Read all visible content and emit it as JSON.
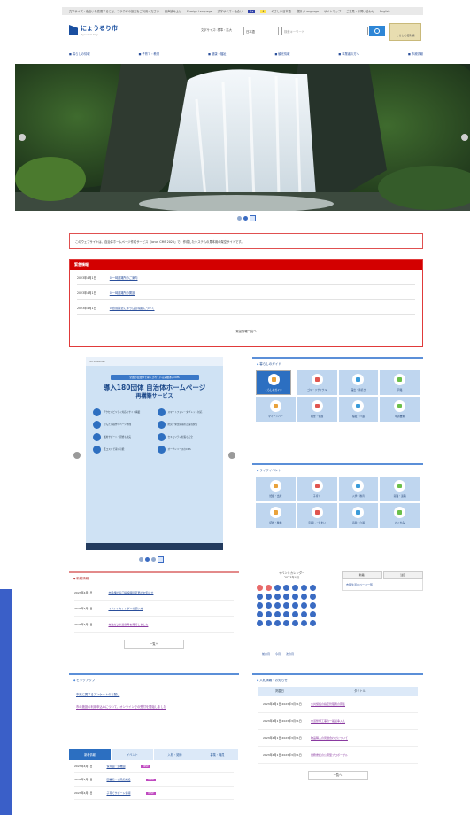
{
  "topbar": {
    "items": [
      "文字サイズ・色合いを変更するには、ブラウザの設定をご利用ください",
      "音声読み上げ",
      "Foreign Language",
      "文字サイズ・色合い",
      "やさしい日本語",
      "翻訳 / Language",
      "サイトマップ",
      "ご意見・お問い合わせ",
      "English"
    ],
    "highlight_a": "Aa",
    "highlight_b": "A"
  },
  "header": {
    "site_name": "にょうるり市",
    "site_sub": "Nyoururi City",
    "font_size_label": "文字サイズ: 標準・拡大",
    "lang_select": "日本語",
    "search_placeholder": "検索キーワード",
    "corner_button": "くらしの便利帳"
  },
  "nav": [
    "暮らしの情報",
    "子育て・教育",
    "健康・福祉",
    "観光情報",
    "事業者の方へ",
    "市政情報"
  ],
  "hero": {
    "slides": 2,
    "active": 1
  },
  "notice": "このウェブサイトは、自治体ホームページ作成サービス「Joruri CMS 2020」で、作成したシステムの見本用の架空サイトです。",
  "disaster": {
    "title": "緊急情報",
    "items": [
      {
        "date": "2023年4月1日",
        "text": "0.一時避難所のご案内"
      },
      {
        "date": "2023年4月1日",
        "text": "0.一時避難所の開設"
      },
      {
        "date": "2023年4月1日",
        "text": "0.台風接近に伴う注意喚起について"
      }
    ],
    "more": "緊急情報一覧へ"
  },
  "banner": {
    "top_label": "SITEBRIDGE",
    "pill": "全国の自治体で導入されている実績あるCMS",
    "title": "導入180団体 自治体ホームページ",
    "subtitle": "再構築サービス",
    "features": [
      "アクセシビリティ対応のサイト構築",
      "スマートフォン・タブレット対応",
      "かんたん操作でページ作成",
      "防災・緊急情報の迅速な発信",
      "運用サポート・研修も充実",
      "セキュリティ対策も万全",
      "低コストで導入可能",
      "オープンソースのCMS"
    ],
    "slides": 3,
    "active": 1
  },
  "life_panel": {
    "title": "暮らしのガイド",
    "tiles": [
      "くらしのガイド",
      "ゴミ・リサイクル",
      "届出・手続き",
      "戸籍",
      "マイナンバー",
      "税金・保険",
      "福祉・介護",
      "申請書類"
    ],
    "selected": 0
  },
  "life_event": {
    "title": "ライフイベント",
    "tiles": [
      "妊娠・出産",
      "子育て",
      "入学・教育",
      "就職・退職",
      "結婚・離婚",
      "引越し・住まい",
      "高齢・介護",
      "おくやみ"
    ]
  },
  "news": {
    "title": "新着情報",
    "items": [
      {
        "date": "2023年4月1日",
        "text": "市民課の窓口開設時間変更のお知らせ",
        "visited": false
      },
      {
        "date": "2023年4月1日",
        "text": "イベントカレンダーの使い方",
        "visited": false
      },
      {
        "date": "2023年4月1日",
        "text": "市政だより最新号を発行しました",
        "visited": true
      }
    ],
    "more": "一覧へ"
  },
  "calendar": {
    "title": "イベントカレンダー",
    "month": "2023年4月",
    "days": 35,
    "links": [
      "前の月",
      "今月",
      "次の月"
    ]
  },
  "tabs_side": {
    "tabs": [
      "新着",
      "注目"
    ],
    "link": "市民生活のページ一覧"
  },
  "pickup": {
    "title": "ピックアップ",
    "link1": "市政に関するアンケートのお願い",
    "link2": "市の施設の利用申込みについて、オンラインでの受付を開始しました"
  },
  "tabbed_news": {
    "tabs": [
      "新着情報",
      "イベント",
      "入札・契約",
      "募集・職員"
    ],
    "items": [
      {
        "date": "2023年4月1日",
        "text": "保育園・幼稚園"
      },
      {
        "date": "2023年4月1日",
        "text": "図書館・公民館施設"
      },
      {
        "date": "2023年4月1日",
        "text": "子育てサポート情報"
      }
    ],
    "badge": "NEW"
  },
  "tender": {
    "title": "入札情報・お知らせ",
    "headers": [
      "掲載日",
      "タイトル"
    ],
    "rows": [
      {
        "date": "2023年4月1日 2023年3月31日",
        "title": "公共施設の指定管理者の募集"
      },
      {
        "date": "2023年4月1日 2023年3月31日",
        "text2": "",
        "title": "市道整備工事の一般競争入札"
      },
      {
        "date": "2023年4月1日 2023年3月31日",
        "title": "物品購入の見積合わせについて"
      },
      {
        "date": "2023年4月1日 2023年3月31日",
        "title": "業務委託の公募型プロポーザル"
      }
    ],
    "more": "一覧へ"
  },
  "colors": {
    "accent_blue": "#2c6fc1",
    "alert_red": "#d30000",
    "side_bar": "#3a5fc8"
  }
}
